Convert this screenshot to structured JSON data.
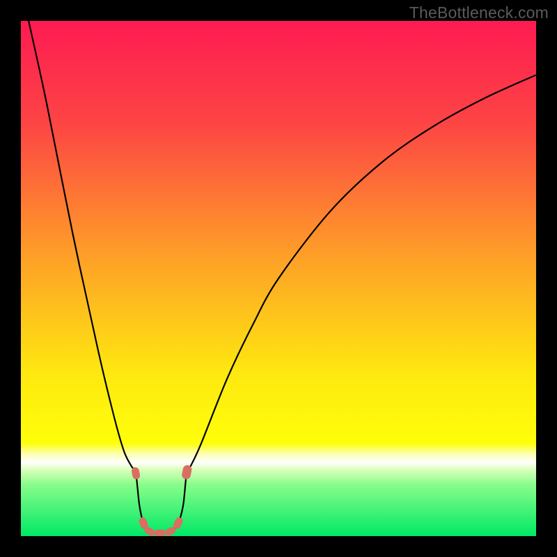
{
  "watermark": "TheBottleneck.com",
  "colors": {
    "frame": "#000000",
    "gradient_stops": [
      {
        "pct": 0,
        "color": "#fd1b52"
      },
      {
        "pct": 20,
        "color": "#fd4544"
      },
      {
        "pct": 45,
        "color": "#fe9d28"
      },
      {
        "pct": 68,
        "color": "#fee710"
      },
      {
        "pct": 82,
        "color": "#ffff0a"
      },
      {
        "pct": 84,
        "color": "#fcffb0"
      },
      {
        "pct": 85.7,
        "color": "#ffffff"
      },
      {
        "pct": 87,
        "color": "#ddffbd"
      },
      {
        "pct": 90,
        "color": "#88fd8a"
      },
      {
        "pct": 100,
        "color": "#00e865"
      }
    ],
    "curve": "#000000",
    "marker": "#d96e63"
  },
  "chart_data": {
    "type": "line",
    "title": "",
    "xlabel": "",
    "ylabel": "",
    "xlim": [
      0,
      100
    ],
    "ylim": [
      0,
      100
    ],
    "curve_points": [
      {
        "x": 1.5,
        "y": 100.0
      },
      {
        "x": 5.0,
        "y": 84.0
      },
      {
        "x": 10.0,
        "y": 59.0
      },
      {
        "x": 15.0,
        "y": 36.0
      },
      {
        "x": 18.0,
        "y": 23.5
      },
      {
        "x": 20.0,
        "y": 16.5
      },
      {
        "x": 21.5,
        "y": 13.5
      },
      {
        "x": 22.3,
        "y": 12.2
      },
      {
        "x": 23.0,
        "y": 6.0
      },
      {
        "x": 23.8,
        "y": 2.5
      },
      {
        "x": 25.0,
        "y": 0.9
      },
      {
        "x": 27.0,
        "y": 0.6
      },
      {
        "x": 29.0,
        "y": 0.9
      },
      {
        "x": 30.5,
        "y": 2.5
      },
      {
        "x": 31.5,
        "y": 6.0
      },
      {
        "x": 32.2,
        "y": 12.4
      },
      {
        "x": 33.0,
        "y": 13.7
      },
      {
        "x": 35.0,
        "y": 18.0
      },
      {
        "x": 40.0,
        "y": 30.5
      },
      {
        "x": 45.0,
        "y": 41.0
      },
      {
        "x": 50.0,
        "y": 50.0
      },
      {
        "x": 60.0,
        "y": 63.0
      },
      {
        "x": 70.0,
        "y": 72.5
      },
      {
        "x": 80.0,
        "y": 79.5
      },
      {
        "x": 90.0,
        "y": 85.0
      },
      {
        "x": 100.0,
        "y": 89.5
      }
    ],
    "markers": [
      {
        "x": 22.3,
        "y": 12.2,
        "r": 6
      },
      {
        "x": 23.8,
        "y": 2.5,
        "r": 6
      },
      {
        "x": 25.0,
        "y": 0.9,
        "r": 5.5
      },
      {
        "x": 27.0,
        "y": 0.6,
        "r": 5.5
      },
      {
        "x": 29.0,
        "y": 0.9,
        "r": 5.5
      },
      {
        "x": 30.5,
        "y": 2.5,
        "r": 6
      },
      {
        "x": 32.2,
        "y": 12.4,
        "r": 7
      }
    ]
  }
}
